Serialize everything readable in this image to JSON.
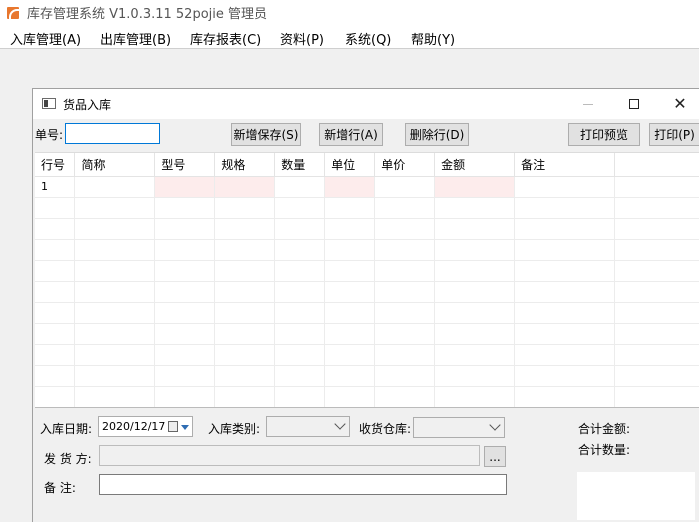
{
  "app": {
    "title": "库存管理系统 V1.0.3.11   52pojie 管理员"
  },
  "menu": [
    {
      "label": "入库管理(A)"
    },
    {
      "label": "出库管理(B)"
    },
    {
      "label": "库存报表(C)"
    },
    {
      "label": "资料(P)"
    },
    {
      "label": "系统(Q)"
    },
    {
      "label": "帮助(Y)"
    }
  ],
  "child": {
    "title": "货品入库",
    "window_controls": {
      "minimize": "—",
      "maximize": "☐",
      "close": "✕"
    }
  },
  "toolbar": {
    "order_no_label": "单号:",
    "order_no_value": "",
    "save_new": "新增保存(S)",
    "add_row": "新增行(A)",
    "delete_row": "删除行(D)",
    "print_preview": "打印预览",
    "print": "打印(P)"
  },
  "grid": {
    "columns": [
      "行号",
      "简称",
      "型号",
      "规格",
      "数量",
      "单位",
      "单价",
      "金额",
      "备注",
      ""
    ],
    "rows": [
      [
        "1",
        "",
        "",
        "",
        "",
        "",
        "",
        "",
        "",
        ""
      ]
    ]
  },
  "form": {
    "date_label": "入库日期:",
    "date_value": "2020/12/17",
    "type_label": "入库类别:",
    "type_value": "",
    "warehouse_label": "收货仓库:",
    "warehouse_value": "",
    "supplier_label": "发 货 方:",
    "supplier_value": "",
    "browse_label": "...",
    "note_label": "备    注:",
    "note_value": ""
  },
  "summary": {
    "total_amount_label": "合计金额:",
    "total_qty_label": "合计数量:"
  },
  "colors": {
    "required_cell": "#fdecec",
    "focus_border": "#0078d7",
    "app_icon": "#e8772e"
  }
}
